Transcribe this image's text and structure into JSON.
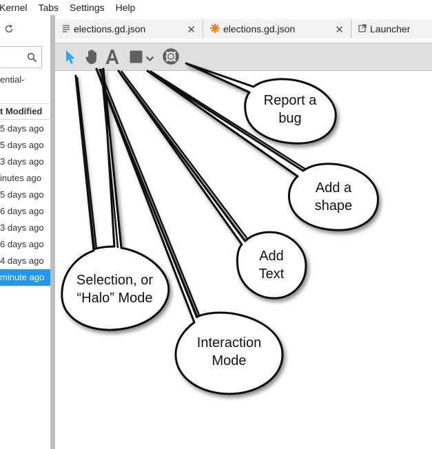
{
  "menu": [
    "Kernel",
    "Tabs",
    "Settings",
    "Help"
  ],
  "sidebar": {
    "breadcrumb": "ential-",
    "column_header": "t Modified",
    "files": [
      "5 days ago",
      "5 days ago",
      "3 days ago",
      "inutes ago",
      "5 days ago",
      "6 days ago",
      "3 days ago",
      "6 days ago",
      "4 days ago",
      "minute ago"
    ],
    "selected_index": 9
  },
  "tabs": [
    {
      "label": "elections.gd.json",
      "icon": "text-file-icon"
    },
    {
      "label": "elections.gd.json",
      "icon": "glowscript-icon"
    },
    {
      "label": "Launcher",
      "icon": "launch-icon"
    }
  ],
  "toolbar": {
    "tools": [
      "select-arrow-icon",
      "hand-icon",
      "text-a-icon",
      "shape-square-icon",
      "chevron-down-icon",
      "lifebuoy-icon"
    ]
  },
  "annotations": {
    "report_bug": [
      "Report a",
      "bug"
    ],
    "add_shape": [
      "Add a",
      "shape"
    ],
    "add_text": [
      "Add",
      "Text"
    ],
    "selection": [
      "Selection, or",
      "“Halo” Mode"
    ],
    "interaction": [
      "Interaction",
      "Mode"
    ]
  },
  "colors": {
    "accent": "#2196f3",
    "select_tool": "#29a8f5",
    "tool_gray": "#616161",
    "glowscript_orange": "#f57c00"
  }
}
